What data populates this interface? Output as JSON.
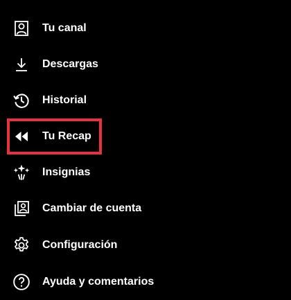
{
  "menu": {
    "items": [
      {
        "id": "channel",
        "label": "Tu canal",
        "icon": "account-box-icon"
      },
      {
        "id": "downloads",
        "label": "Descargas",
        "icon": "download-icon"
      },
      {
        "id": "history",
        "label": "Historial",
        "icon": "history-icon"
      },
      {
        "id": "recap",
        "label": "Tu Recap",
        "icon": "rewind-icon"
      },
      {
        "id": "badges",
        "label": "Insignias",
        "icon": "sparkle-badges-icon"
      },
      {
        "id": "switch-account",
        "label": "Cambiar de cuenta",
        "icon": "switch-account-icon"
      },
      {
        "id": "settings",
        "label": "Configuración",
        "icon": "gear-icon"
      },
      {
        "id": "help",
        "label": "Ayuda y comentarios",
        "icon": "help-circle-icon"
      }
    ]
  },
  "annotation": {
    "highlighted_item": "Tu Recap",
    "highlight_color": "#e5323f"
  },
  "colors": {
    "background": "#000000",
    "text": "#ffffff"
  }
}
